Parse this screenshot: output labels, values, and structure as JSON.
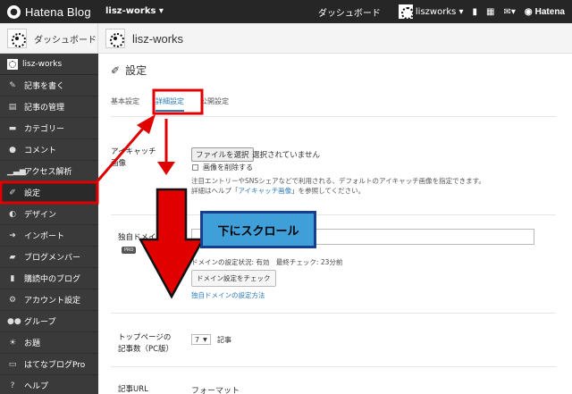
{
  "topbar": {
    "brand": "Hatena Blog",
    "blog_selector": "lisz-works ▾",
    "dashboard": "ダッシュボード",
    "user": "liszworks ▾",
    "hatena": "Hatena"
  },
  "subbar": {
    "dashboard": "ダッシュボード",
    "blog_name": "lisz-works"
  },
  "sidebar": {
    "blog": "lisz-works",
    "items": [
      {
        "label": "記事を書く",
        "icon": "pencil-icon"
      },
      {
        "label": "記事の管理",
        "icon": "file-icon"
      },
      {
        "label": "カテゴリー",
        "icon": "folder-icon"
      },
      {
        "label": "コメント",
        "icon": "comment-icon"
      },
      {
        "label": "アクセス解析",
        "icon": "chart-icon"
      },
      {
        "label": "設定",
        "icon": "wrench-icon"
      },
      {
        "label": "デザイン",
        "icon": "palette-icon"
      },
      {
        "label": "インポート",
        "icon": "import-icon"
      },
      {
        "label": "ブログメンバー",
        "icon": "members-icon"
      },
      {
        "label": "購読中のブログ",
        "icon": "book-icon"
      },
      {
        "label": "アカウント設定",
        "icon": "gear-icon"
      },
      {
        "label": "グループ",
        "icon": "group-icon"
      },
      {
        "label": "お題",
        "icon": "bulb-icon"
      },
      {
        "label": "はてなブログPro",
        "icon": "pro-icon"
      },
      {
        "label": "ヘルプ",
        "icon": "help-icon"
      }
    ]
  },
  "main": {
    "title": "設定",
    "tabs": [
      "基本設定",
      "詳細設定",
      "公開設定"
    ],
    "eyecatch_label": "アイキャッチ画像",
    "file_button": "ファイルを選択",
    "file_status": "選択されていません",
    "delete_image": "画像を削除する",
    "help_line1": "注目エントリーやSNSシェアなどで利用される、デフォルトのアイキャッチ画像を指定できます。",
    "help_line2_pre": "詳細はヘルプ「",
    "help_line2_link": "アイキャッチ画像",
    "help_line2_post": "」を参照してください。",
    "domain_label": "独自ドメイン",
    "pro_badge": "PRO",
    "domain_status": "ドメインの設定状況: 有効　最終チェック: 23分前",
    "domain_check_button": "ドメイン設定をチェック",
    "domain_link": "独自ドメインの設定方法",
    "top_entries_label": "トップページの\n記事数（PC版）",
    "top_entries_value": "7",
    "top_entries_unit": "記事",
    "entry_url_label": "記事URL",
    "entry_url_value": "フォーマット"
  },
  "annotation": {
    "scroll_text": "下にスクロール",
    "box_color": "#e00000",
    "arrow_color": "#e00000"
  }
}
